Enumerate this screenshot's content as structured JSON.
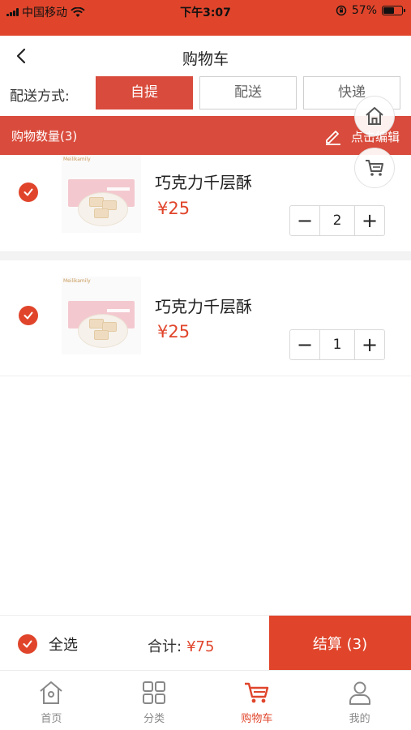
{
  "status_bar": {
    "carrier": "中国移动",
    "time": "下午3:07",
    "battery": "57%",
    "icons": [
      "signal-icon",
      "wifi-icon",
      "rotation-lock-icon",
      "battery-icon"
    ]
  },
  "nav": {
    "title": "购物车",
    "back_icon": "chevron-left-icon"
  },
  "delivery": {
    "label": "配送方式:",
    "options": [
      {
        "label": "自提",
        "active": true
      },
      {
        "label": "配送",
        "active": false
      },
      {
        "label": "快递",
        "active": false
      }
    ]
  },
  "cart_header": {
    "count_label": "购物数量(3)",
    "edit_label": "点击编辑",
    "edit_icon": "pencil-icon"
  },
  "floating": {
    "home_icon": "home-icon",
    "cart_icon": "cart-icon"
  },
  "items": [
    {
      "name": "巧克力千层酥",
      "price": "¥25",
      "quantity": "2",
      "checked": true,
      "image_brand": "Meilikamily"
    },
    {
      "name": "巧克力千层酥",
      "price": "¥25",
      "quantity": "1",
      "checked": true,
      "image_brand": "Meilikamily"
    }
  ],
  "footer": {
    "select_all": "全选",
    "total_label": "合计:",
    "total_amount": "¥75",
    "checkout": "结算 (3)"
  },
  "tabs": [
    {
      "label": "首页",
      "icon": "home-icon",
      "active": false
    },
    {
      "label": "分类",
      "icon": "category-grid-icon",
      "active": false
    },
    {
      "label": "购物车",
      "icon": "cart-icon",
      "active": true
    },
    {
      "label": "我的",
      "icon": "user-icon",
      "active": false
    }
  ],
  "colors": {
    "accent": "#e0452b",
    "active_option": "#d94b3c"
  }
}
